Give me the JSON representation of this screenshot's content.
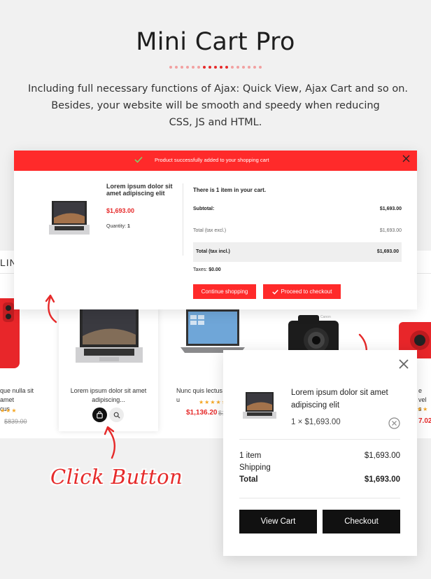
{
  "header": {
    "title": "Mini Cart Pro",
    "intro_line1": "Including full necessary functions of Ajax: Quick View,  Ajax Cart and so on.",
    "intro_line2": "Besides, your website will be smooth and speedy when reducing",
    "intro_line3": "CSS, JS and HTML."
  },
  "background_strip": {
    "partial_heading": "LINC",
    "products": [
      {
        "name": "que nulla sit amet\ncus",
        "old_price": "$839.00"
      },
      {
        "name": "Lorem ipsum dolor sit amet\nadipiscing...",
        "highlighted": true
      },
      {
        "name": "Nunc quis lectus u",
        "price": "$1,136.20",
        "old_price": "$1"
      },
      {
        "name": "Camera"
      },
      {
        "name": "e vel s",
        "price": "7.02"
      }
    ]
  },
  "success_modal": {
    "message": "Product successfully added to your shopping cart",
    "product_name": "Lorem ipsum dolor sit amet adipiscing elit",
    "product_price": "$1,693.00",
    "quantity_label": "Quantity:",
    "quantity_value": "1",
    "items_text": "There is 1 item in your cart.",
    "subtotal_label": "Subtotal:",
    "subtotal_value": "$1,693.00",
    "tax_excl_label": "Total (tax excl.)",
    "tax_excl_value": "$1,693.00",
    "tax_incl_label": "Total (tax incl.)",
    "tax_incl_value": "$1,693.00",
    "taxes_label": "Taxes:",
    "taxes_value": "$0.00",
    "continue_label": "Continue shopping",
    "checkout_label": "Proceed to checkout"
  },
  "side_cart": {
    "product_name": "Lorem ipsum dolor sit amet adipiscing elit",
    "qty_price": "1 × $1,693.00",
    "item_count_label": "1 item",
    "item_count_value": "$1,693.00",
    "shipping_label": "Shipping",
    "total_label": "Total",
    "total_value": "$1,693.00",
    "view_cart_label": "View Cart",
    "checkout_label": "Checkout"
  },
  "annotation": {
    "click_label": "Click Button"
  },
  "colors": {
    "accent": "#ff2a2a",
    "dark": "#111111",
    "star": "#f5a623"
  }
}
